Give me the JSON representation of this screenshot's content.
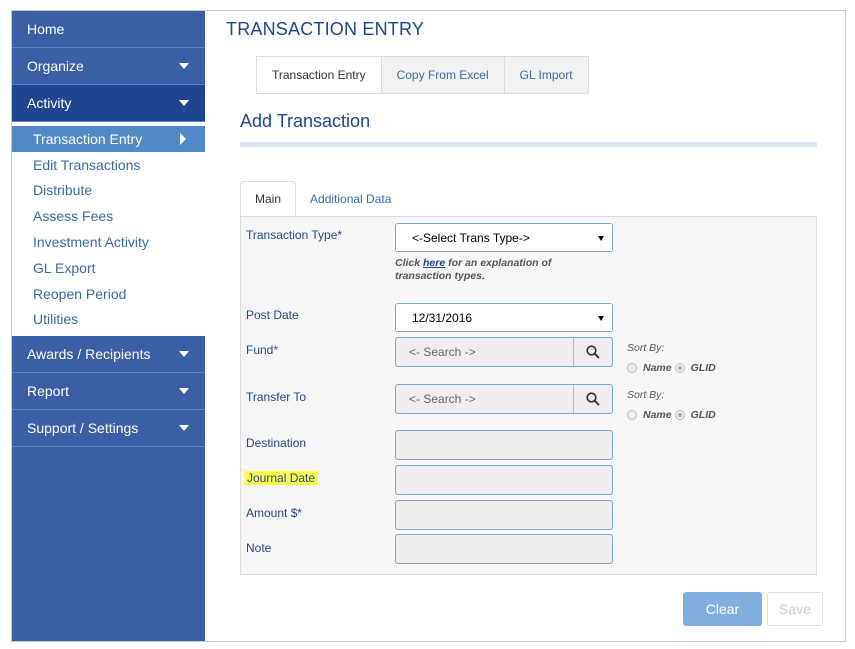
{
  "sidebar": {
    "home": "Home",
    "organize": "Organize",
    "activity": "Activity",
    "sub_items": [
      "Transaction Entry",
      "Edit Transactions",
      "Distribute",
      "Assess Fees",
      "Investment Activity",
      "GL Export",
      "Reopen Period",
      "Utilities"
    ],
    "awards": "Awards / Recipients",
    "report": "Report",
    "support": "Support / Settings"
  },
  "main": {
    "title": "TRANSACTION ENTRY",
    "tabs": [
      "Transaction Entry",
      "Copy From Excel",
      "GL Import"
    ],
    "section_title": "Add Transaction",
    "inner_tabs": [
      "Main",
      "Additional Data"
    ]
  },
  "form": {
    "transaction_type_label": "Transaction Type*",
    "transaction_type_value": "<-Select Trans Type->",
    "help_prefix": "Click ",
    "help_link": "here",
    "help_suffix": " for an explanation of transaction types.",
    "post_date_label": "Post Date",
    "post_date_value": "12/31/2016",
    "fund_label": "Fund*",
    "fund_placeholder": "<- Search ->",
    "transfer_to_label": "Transfer To",
    "transfer_placeholder": "<- Search ->",
    "sort_by": "Sort By:",
    "sort_name": "Name",
    "sort_glid": "GLID",
    "destination_label": "Destination",
    "journal_date_label": "Journal Date",
    "amount_label": "Amount $*",
    "note_label": "Note"
  },
  "buttons": {
    "clear": "Clear",
    "save": "Save"
  },
  "colors": {
    "sidebar": "#3a5fa4",
    "sidebar_active": "#1f4690",
    "sub_current": "#4f89c6",
    "highlight": "#ffff4d",
    "clear_button": "#7fb0e0"
  }
}
